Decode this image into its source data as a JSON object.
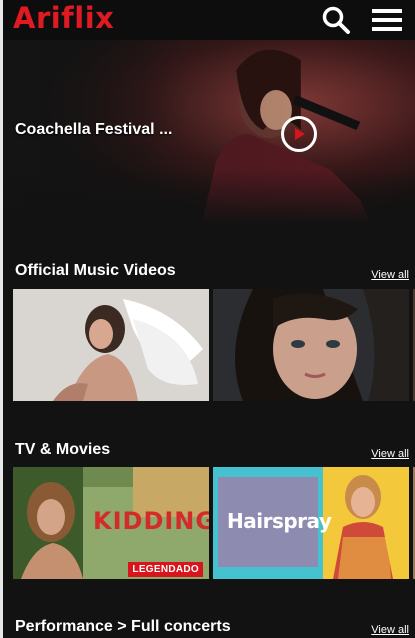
{
  "app": {
    "logo": "Ariflix"
  },
  "header": {
    "search_icon": "search-icon",
    "menu_icon": "hamburger-menu-icon"
  },
  "hero": {
    "title": "Coachella Festival ...",
    "play_icon": "play-icon"
  },
  "sections": [
    {
      "title": "Official Music Videos",
      "view_all": "View all"
    },
    {
      "title": "TV & Movies",
      "view_all": "View all",
      "cards": [
        {
          "logo_text": "KIDDING",
          "badge": "LEGENDADO"
        },
        {
          "logo_text": "Hairspray"
        }
      ]
    },
    {
      "title": "Performance > Full concerts",
      "view_all": "View all"
    }
  ],
  "colors": {
    "brand": "#e01a22",
    "background": "#121212",
    "badge": "#d8141c"
  }
}
